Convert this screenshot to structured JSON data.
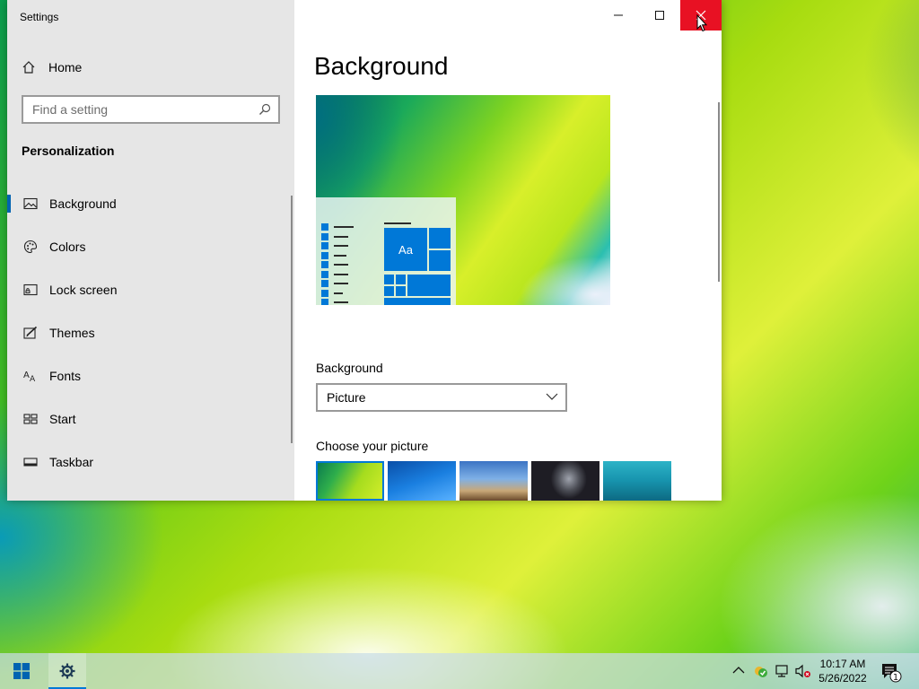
{
  "window": {
    "title": "Settings",
    "home_label": "Home",
    "search_placeholder": "Find a setting",
    "section_title": "Personalization",
    "nav_items": [
      {
        "label": "Background",
        "icon": "picture-icon",
        "selected": true
      },
      {
        "label": "Colors",
        "icon": "palette-icon"
      },
      {
        "label": "Lock screen",
        "icon": "lock-screen-icon"
      },
      {
        "label": "Themes",
        "icon": "themes-brush-icon"
      },
      {
        "label": "Fonts",
        "icon": "fonts-icon"
      },
      {
        "label": "Start",
        "icon": "start-tiles-icon"
      },
      {
        "label": "Taskbar",
        "icon": "taskbar-icon"
      }
    ]
  },
  "content": {
    "page_title": "Background",
    "preview_sample_text": "Aa",
    "background_label": "Background",
    "background_value": "Picture",
    "choose_picture_label": "Choose your picture"
  },
  "taskbar": {
    "time": "10:17 AM",
    "date": "5/26/2022",
    "notification_count": "1"
  },
  "colors": {
    "accent": "#0078d7",
    "close_hover": "#e81123",
    "nav_background": "#e6e6e6"
  }
}
